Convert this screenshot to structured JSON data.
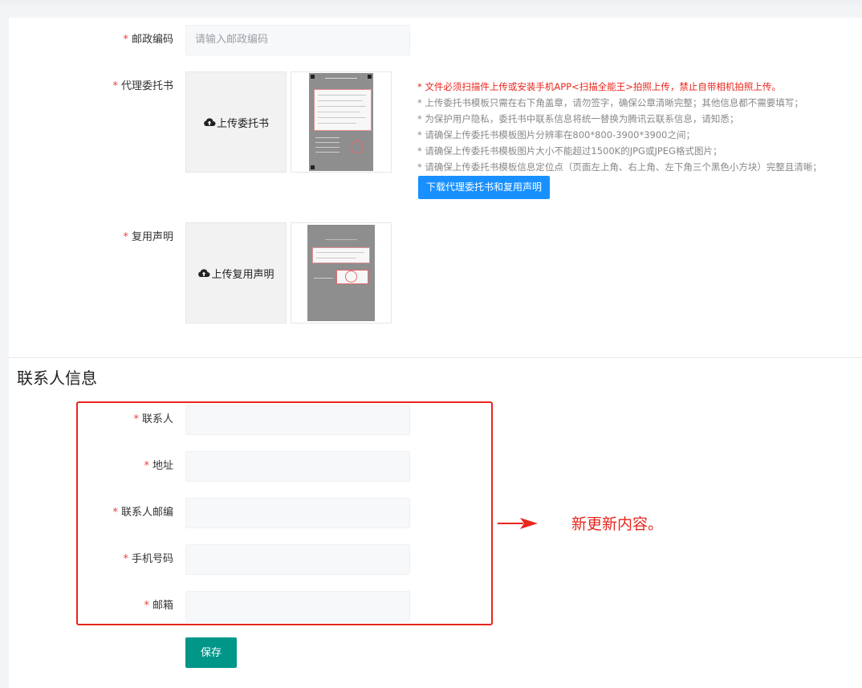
{
  "form": {
    "postcode": {
      "label": "邮政编码",
      "placeholder": "请输入邮政编码"
    },
    "attorney": {
      "label": "代理委托书",
      "upload_label": "上传委托书"
    },
    "reuse": {
      "label": "复用声明",
      "upload_label": "上传复用声明"
    }
  },
  "notes": [
    "* 文件必须扫描件上传或安装手机APP<扫描全能王>拍照上传，禁止自带相机拍照上传。",
    "* 上传委托书模板只需在右下角盖章，请勿签字，确保公章清晰完整；其他信息都不需要填写；",
    "* 为保护用户隐私，委托书中联系信息将统一替换为腾讯云联系信息，请知悉；",
    "* 请确保上传委托书模板图片分辨率在800*800-3900*3900之间；",
    "* 请确保上传委托书模板图片大小不能超过1500K的JPG或JPEG格式图片；",
    "* 请确保上传委托书模板信息定位点（页面左上角、右上角、左下角三个黑色小方块）完整且清晰；"
  ],
  "download_button": "下载代理委托书和复用声明",
  "contact": {
    "section_title": "联系人信息",
    "required_mark": "*",
    "fields": {
      "name": {
        "label": "联系人",
        "value": ""
      },
      "address": {
        "label": "地址",
        "value": ""
      },
      "zip": {
        "label": "联系人邮编",
        "value": ""
      },
      "phone": {
        "label": "手机号码",
        "value": ""
      },
      "email": {
        "label": "邮箱",
        "value": ""
      }
    }
  },
  "annotation": "新更新内容。",
  "save_button": "保存",
  "colors": {
    "required": "#e64340",
    "warning": "#e8261d",
    "primary_blue": "#1890ff",
    "save_green": "#009688",
    "annotation_red": "#e8261d"
  },
  "icons": {
    "upload": "cloud-upload-icon",
    "arrow": "arrow-right-icon"
  }
}
